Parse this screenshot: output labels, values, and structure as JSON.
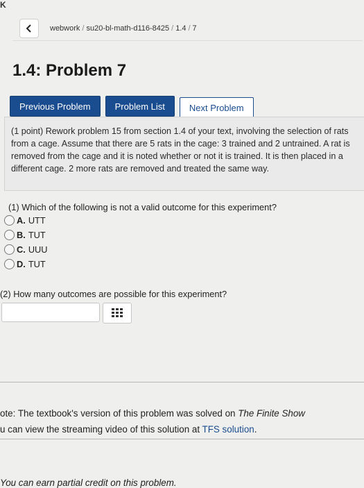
{
  "breadcrumb": {
    "back_icon": "chevron-left-icon",
    "items": [
      "webwork",
      "su20-bl-math-d116-8425",
      "1.4",
      "7"
    ]
  },
  "title": "1.4: Problem 7",
  "nav": {
    "previous": "Previous Problem",
    "list": "Problem List",
    "next": "Next Problem"
  },
  "problem": {
    "text": "(1 point) Rework problem 15 from section 1.4 of your text, involving the selection of rats from a cage. Assume that there are 5 rats in the cage: 3 trained and 2 untrained. A rat is removed from the cage and it is noted whether or not it is trained. It is then placed in a different cage. 2 more rats are removed and treated the same way."
  },
  "question1": {
    "text": "(1) Which of the following is not a valid outcome for this experiment?",
    "options": [
      {
        "label": "A.",
        "text": "UTT"
      },
      {
        "label": "B.",
        "text": "TUT"
      },
      {
        "label": "C.",
        "text": "UUU"
      },
      {
        "label": "D.",
        "text": "TUT"
      }
    ]
  },
  "question2": {
    "text": "(2) How many outcomes are possible for this experiment?",
    "answer_value": "",
    "keypad_icon": "grid-keypad-icon"
  },
  "note": {
    "line1_prefix": "ote: The textbook's version of this problem was solved on ",
    "line1_italic": "The Finite Show",
    "line2_prefix": "u can view the streaming video of this solution at ",
    "line2_link": "TFS solution",
    "line2_suffix": "."
  },
  "footer": {
    "text": "You can earn partial credit on this problem."
  }
}
